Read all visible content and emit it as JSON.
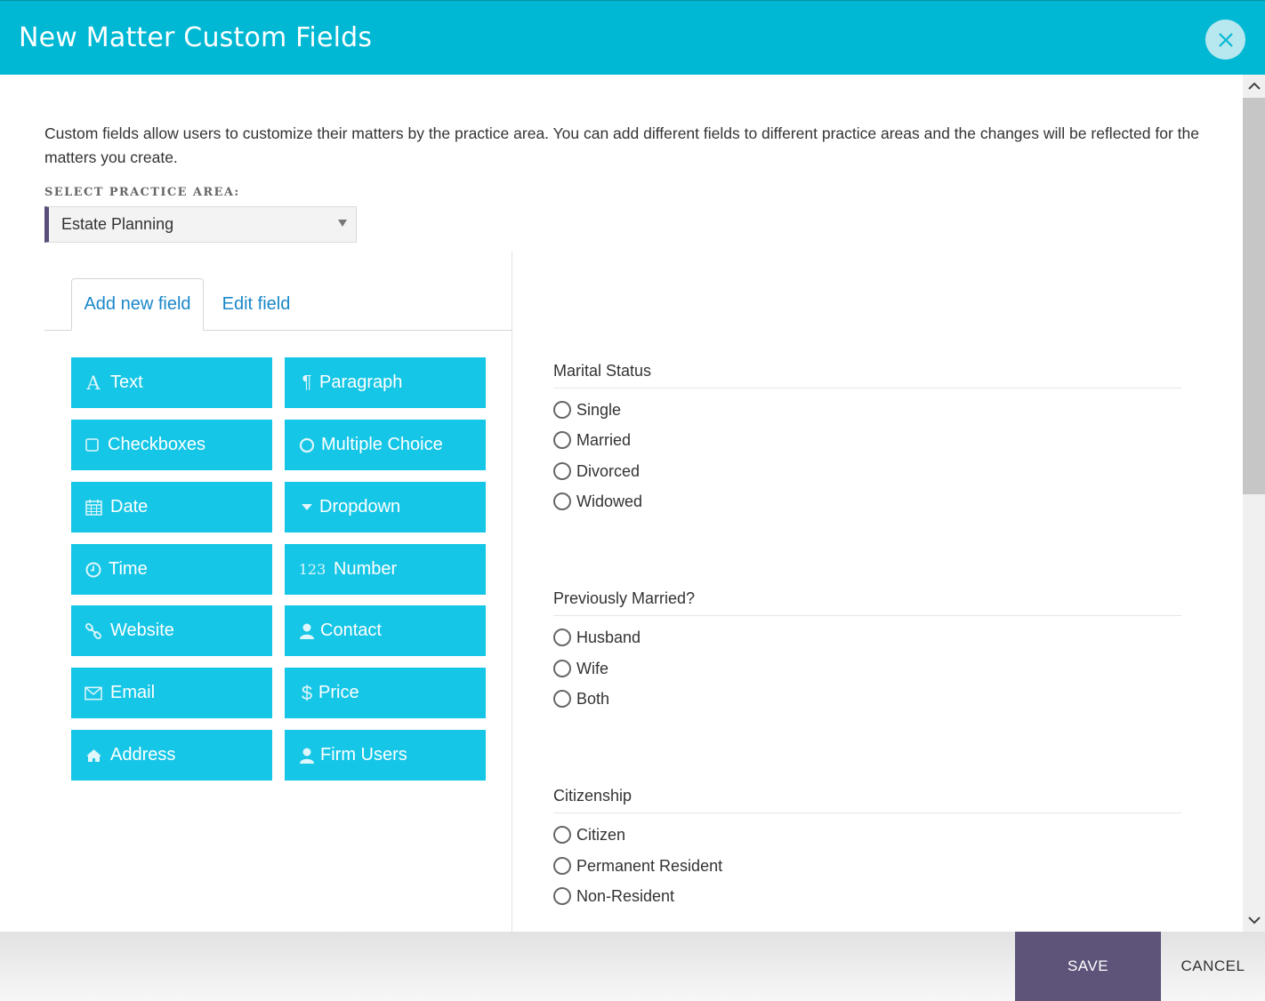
{
  "dialog": {
    "title": "New Matter Custom Fields",
    "close_icon": "close-icon",
    "accent_color": "#00b8d4"
  },
  "intro_text": "Custom fields allow users to customize their matters by the practice area. You can add different fields to different practice areas and the changes will be reflected for the matters you create.",
  "practice_area": {
    "label": "SELECT PRACTICE AREA:",
    "selected": "Estate Planning"
  },
  "tabs": [
    {
      "label": "Add new field",
      "active": true
    },
    {
      "label": "Edit field",
      "active": false
    }
  ],
  "field_types": [
    {
      "label": "Text",
      "icon": "text-icon"
    },
    {
      "label": "Paragraph",
      "icon": "paragraph-icon"
    },
    {
      "label": "Checkboxes",
      "icon": "checkbox-icon"
    },
    {
      "label": "Multiple Choice",
      "icon": "radio-icon"
    },
    {
      "label": "Date",
      "icon": "calendar-icon"
    },
    {
      "label": "Dropdown",
      "icon": "caret-down-icon"
    },
    {
      "label": "Time",
      "icon": "clock-icon"
    },
    {
      "label": "Number",
      "icon": "number-icon",
      "icon_text": "123"
    },
    {
      "label": "Website",
      "icon": "link-icon"
    },
    {
      "label": "Contact",
      "icon": "user-icon"
    },
    {
      "label": "Email",
      "icon": "envelope-icon"
    },
    {
      "label": "Price",
      "icon": "dollar-icon",
      "icon_text": "$"
    },
    {
      "label": "Address",
      "icon": "home-icon"
    },
    {
      "label": "Firm Users",
      "icon": "user-icon"
    }
  ],
  "preview_fields": [
    {
      "title": "Marital Status",
      "options": [
        "Single",
        "Married",
        "Divorced",
        "Widowed"
      ]
    },
    {
      "title": "Previously Married?",
      "options": [
        "Husband",
        "Wife",
        "Both"
      ]
    },
    {
      "title": "Citizenship",
      "options": [
        "Citizen",
        "Permanent Resident",
        "Non-Resident"
      ]
    }
  ],
  "footer": {
    "save_label": "SAVE",
    "cancel_label": "CANCEL",
    "save_color": "#5e5479"
  }
}
